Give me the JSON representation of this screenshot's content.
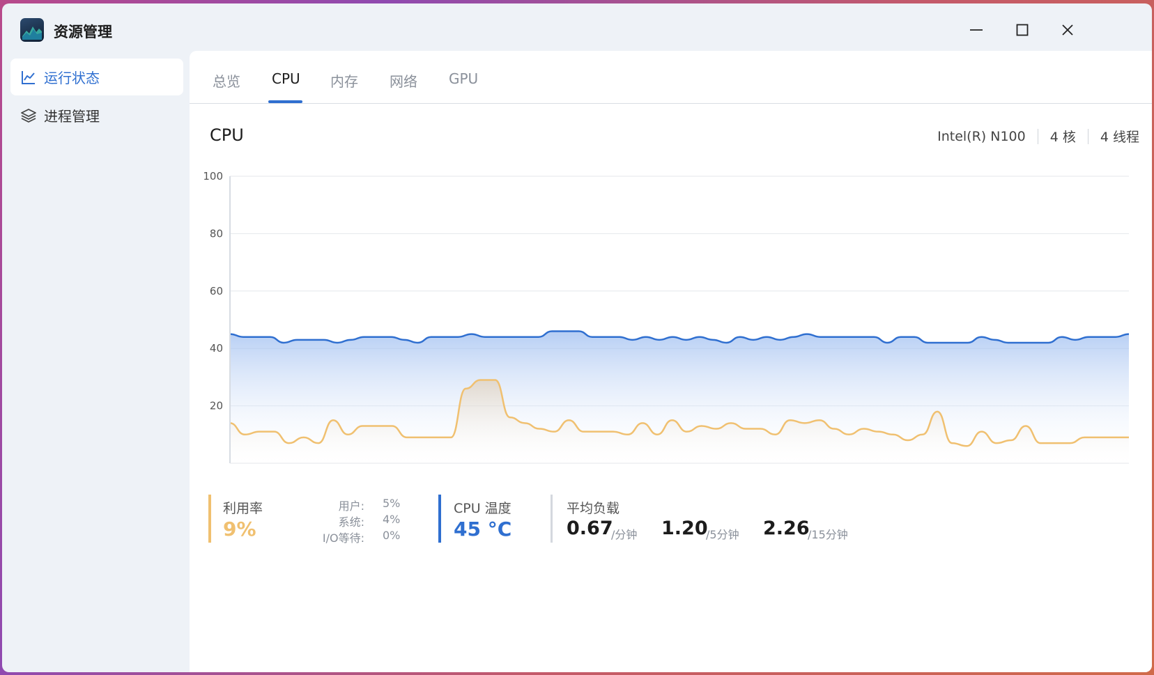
{
  "app": {
    "title": "资源管理"
  },
  "window_controls": {
    "minimize": "minimize-icon",
    "maximize": "maximize-icon",
    "close": "close-icon"
  },
  "sidebar": {
    "items": [
      {
        "label": "运行状态",
        "icon": "line-chart-icon",
        "active": true
      },
      {
        "label": "进程管理",
        "icon": "layers-icon",
        "active": false
      }
    ]
  },
  "tabs": [
    {
      "label": "总览",
      "active": false
    },
    {
      "label": "CPU",
      "active": true
    },
    {
      "label": "内存",
      "active": false
    },
    {
      "label": "网络",
      "active": false
    },
    {
      "label": "GPU",
      "active": false
    }
  ],
  "cpu": {
    "title": "CPU",
    "model": "Intel(R) N100",
    "cores": "4 核",
    "threads": "4 线程"
  },
  "chart_data": {
    "type": "area",
    "ylim": [
      0,
      100
    ],
    "yticks": [
      "100",
      "80",
      "60",
      "40",
      "20"
    ],
    "grid": true,
    "series": [
      {
        "color": "#2f6fd0",
        "values": [
          45,
          44,
          44,
          44,
          42,
          43,
          43,
          43,
          42,
          43,
          44,
          44,
          44,
          43,
          42,
          44,
          44,
          44,
          45,
          44,
          44,
          44,
          44,
          44,
          46,
          46,
          46,
          44,
          44,
          44,
          43,
          44,
          43,
          44,
          43,
          44,
          43,
          42,
          44,
          43,
          44,
          43,
          44,
          45,
          44,
          44,
          44,
          44,
          44,
          42,
          44,
          44,
          42,
          42,
          42,
          42,
          44,
          43,
          42,
          42,
          42,
          42,
          44,
          43,
          44,
          44,
          44,
          45
        ]
      },
      {
        "color": "#f0c070",
        "values": [
          14,
          10,
          11,
          11,
          7,
          9,
          7,
          15,
          10,
          13,
          13,
          13,
          9,
          9,
          9,
          9,
          26,
          29,
          29,
          16,
          14,
          12,
          11,
          15,
          11,
          11,
          11,
          10,
          14,
          10,
          15,
          11,
          13,
          12,
          14,
          12,
          12,
          10,
          15,
          14,
          15,
          12,
          10,
          12,
          11,
          10,
          8,
          10,
          18,
          7,
          6,
          11,
          7,
          8,
          13,
          7,
          7,
          7,
          9,
          9,
          9,
          9
        ]
      }
    ]
  },
  "stats": {
    "utilization": {
      "label": "利用率",
      "value": "9%",
      "color": "#f0c070",
      "user_label": "用户:",
      "user_value": "5%",
      "system_label": "系统:",
      "system_value": "4%",
      "io_label": "I/O等待:",
      "io_value": "0%"
    },
    "temperature": {
      "label": "CPU 温度",
      "value": "45 °C",
      "color": "#2f6fd0"
    },
    "load": {
      "label": "平均负载",
      "m1_value": "0.67",
      "m1_unit": "/分钟",
      "m5_value": "1.20",
      "m5_unit": "/5分钟",
      "m15_value": "2.26",
      "m15_unit": "/15分钟"
    }
  }
}
